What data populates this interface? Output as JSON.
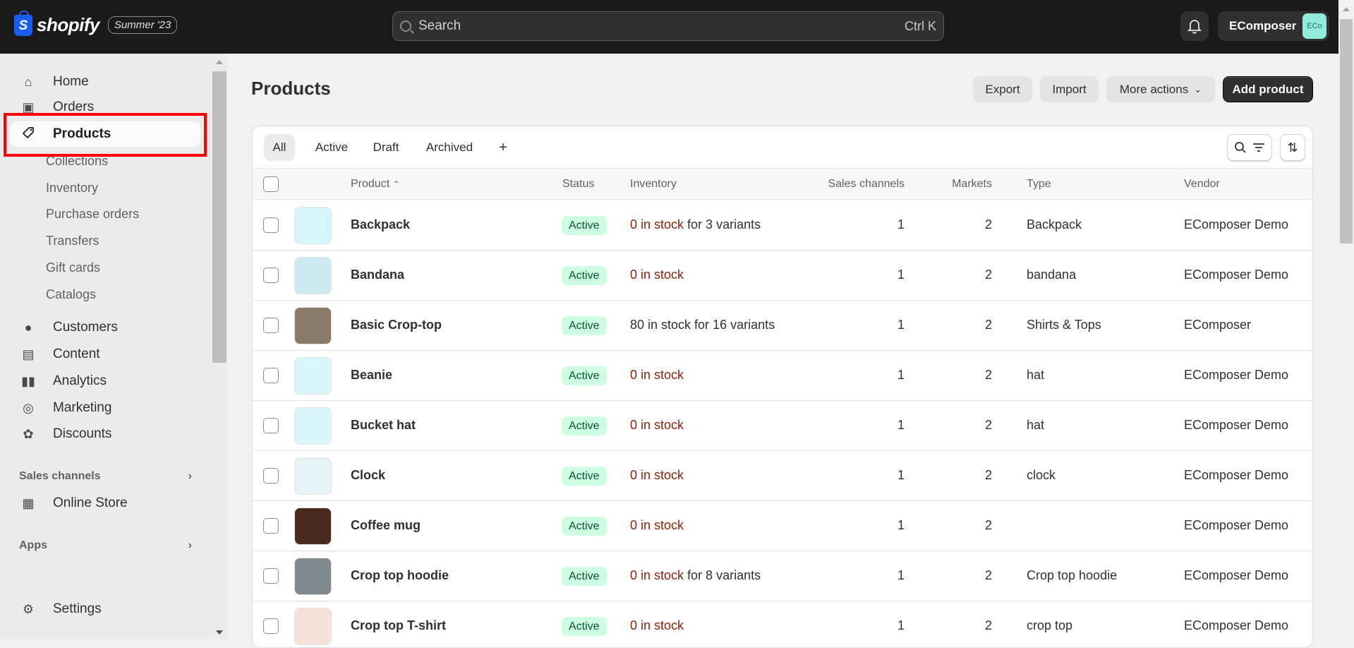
{
  "topbar": {
    "brand": "shopify",
    "edition": "Summer '23",
    "search_placeholder": "Search",
    "search_shortcut": "Ctrl K",
    "notifications_icon": "bell-icon",
    "store_name": "EComposer",
    "avatar_initials": "ECo"
  },
  "sidebar": {
    "items": [
      {
        "label": "Home",
        "icon": "home-icon"
      },
      {
        "label": "Orders",
        "icon": "inbox-icon"
      },
      {
        "label": "Products",
        "icon": "tag-icon",
        "active": true
      },
      {
        "label": "Customers",
        "icon": "person-icon"
      },
      {
        "label": "Content",
        "icon": "image-icon"
      },
      {
        "label": "Analytics",
        "icon": "bar-chart-icon"
      },
      {
        "label": "Marketing",
        "icon": "target-icon"
      },
      {
        "label": "Discounts",
        "icon": "discount-icon"
      }
    ],
    "product_subitems": [
      "Collections",
      "Inventory",
      "Purchase orders",
      "Transfers",
      "Gift cards",
      "Catalogs"
    ],
    "sales_channels_label": "Sales channels",
    "online_store_label": "Online Store",
    "apps_label": "Apps",
    "settings_label": "Settings"
  },
  "page": {
    "title": "Products",
    "actions": {
      "export": "Export",
      "import": "Import",
      "more": "More actions",
      "add": "Add product"
    }
  },
  "tabs": [
    "All",
    "Active",
    "Draft",
    "Archived",
    "+"
  ],
  "selected_tab": "All",
  "table": {
    "headers": {
      "product": "Product",
      "status": "Status",
      "inventory": "Inventory",
      "sales_channels": "Sales channels",
      "markets": "Markets",
      "type": "Type",
      "vendor": "Vendor"
    },
    "rows": [
      {
        "name": "Backpack",
        "status": "Active",
        "stock": "0 in stock",
        "variants": " for 3 variants",
        "out": true,
        "channels": "1",
        "markets": "2",
        "type": "Backpack",
        "vendor": "EComposer Demo",
        "thumb": "#d6f5fb"
      },
      {
        "name": "Bandana",
        "status": "Active",
        "stock": "0 in stock",
        "variants": "",
        "out": true,
        "channels": "1",
        "markets": "2",
        "type": "bandana",
        "vendor": "EComposer Demo",
        "thumb": "#cdeaf1"
      },
      {
        "name": "Basic Crop-top",
        "status": "Active",
        "stock": "80 in stock for 16 variants",
        "variants": "",
        "out": false,
        "channels": "1",
        "markets": "2",
        "type": "Shirts & Tops",
        "vendor": "EComposer",
        "thumb": "#8a7a6a"
      },
      {
        "name": "Beanie",
        "status": "Active",
        "stock": "0 in stock",
        "variants": "",
        "out": true,
        "channels": "1",
        "markets": "2",
        "type": "hat",
        "vendor": "EComposer Demo",
        "thumb": "#d9f6fc"
      },
      {
        "name": "Bucket hat",
        "status": "Active",
        "stock": "0 in stock",
        "variants": "",
        "out": true,
        "channels": "1",
        "markets": "2",
        "type": "hat",
        "vendor": "EComposer Demo",
        "thumb": "#d9f6fc"
      },
      {
        "name": "Clock",
        "status": "Active",
        "stock": "0 in stock",
        "variants": "",
        "out": true,
        "channels": "1",
        "markets": "2",
        "type": "clock",
        "vendor": "EComposer Demo",
        "thumb": "#e6f4f8"
      },
      {
        "name": "Coffee mug",
        "status": "Active",
        "stock": "0 in stock",
        "variants": "",
        "out": true,
        "channels": "1",
        "markets": "2",
        "type": "",
        "vendor": "EComposer Demo",
        "thumb": "#4a2a1e"
      },
      {
        "name": "Crop top hoodie",
        "status": "Active",
        "stock": "0 in stock",
        "variants": " for 8 variants",
        "out": true,
        "channels": "1",
        "markets": "2",
        "type": "Crop top hoodie",
        "vendor": "EComposer Demo",
        "thumb": "#7f8a8f"
      },
      {
        "name": "Crop top T-shirt",
        "status": "Active",
        "stock": "0 in stock",
        "variants": "",
        "out": true,
        "channels": "1",
        "markets": "2",
        "type": "crop top",
        "vendor": "EComposer Demo",
        "thumb": "#f6e0da"
      }
    ]
  },
  "colors": {
    "topbar": "#1a1a1a",
    "active_badge_bg": "#cdfee1",
    "active_badge_text": "#0c5132",
    "out_of_stock": "#8e1f0b",
    "primary_button": "#303030",
    "highlight_box": "#ff0000"
  }
}
